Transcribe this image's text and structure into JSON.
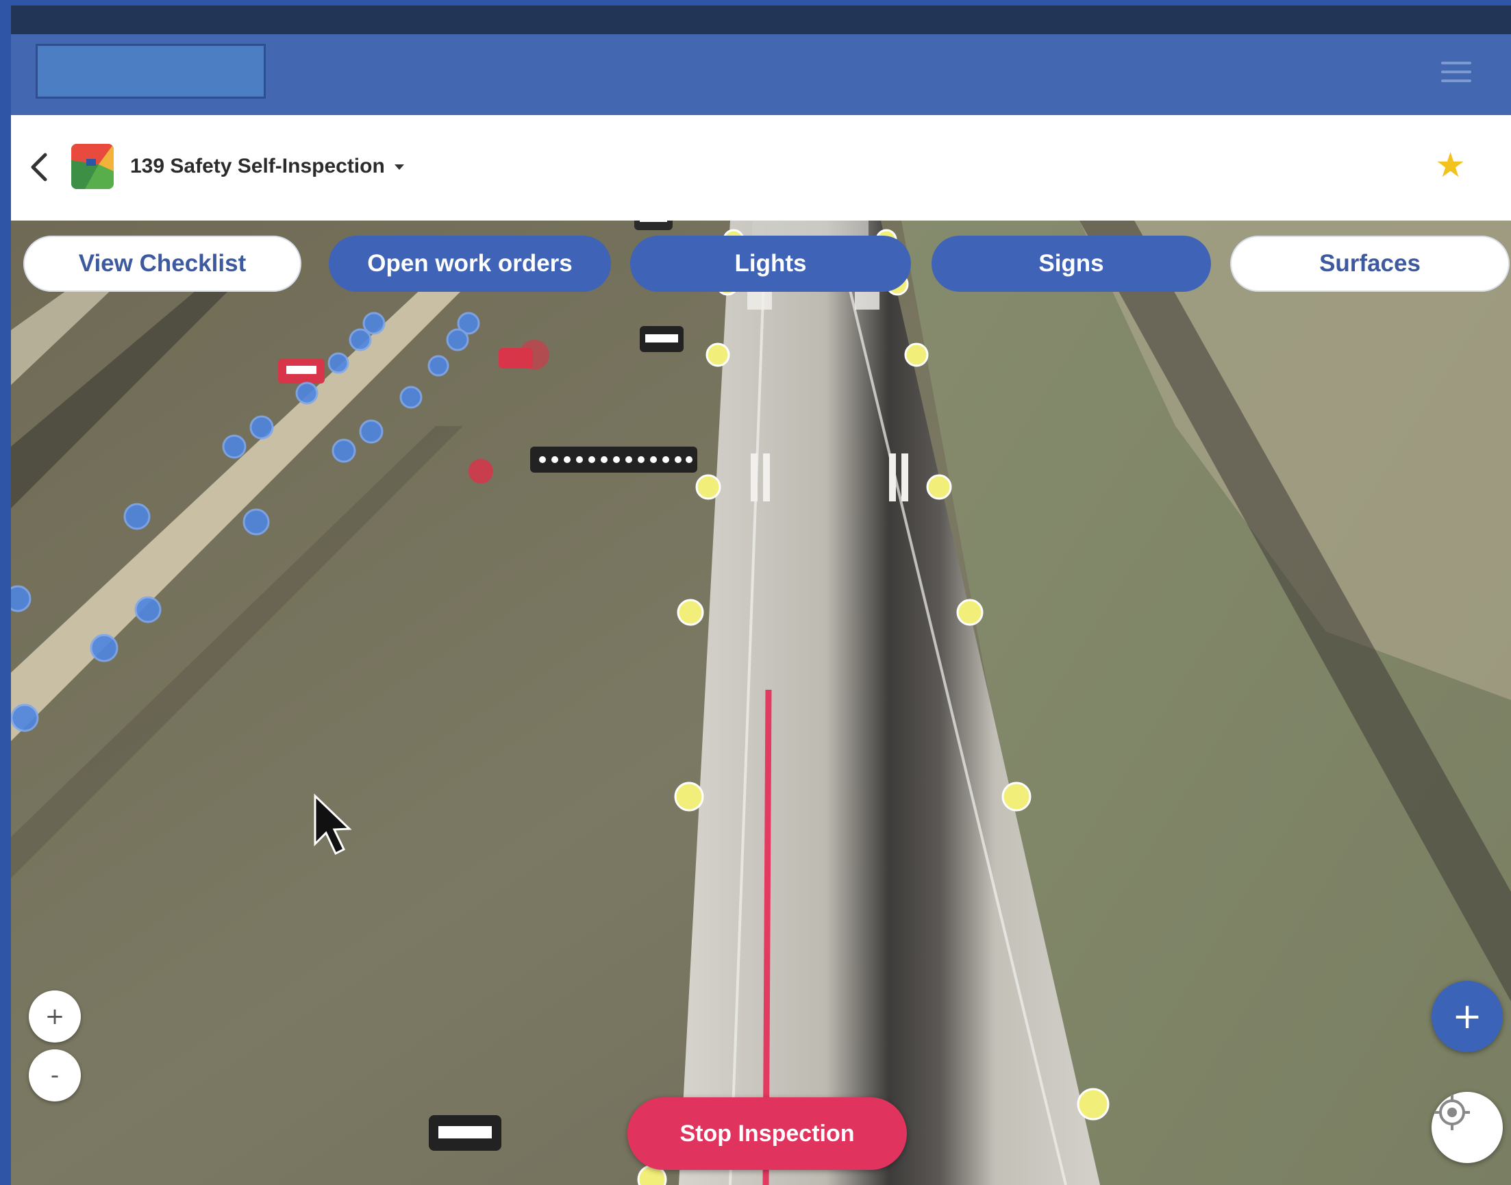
{
  "header": {
    "title": "139 Safety Self-Inspection",
    "icons": {
      "menu": "hamburger-menu-icon",
      "back": "back-chevron-icon",
      "favorite": "star-icon"
    }
  },
  "filters": [
    {
      "label": "View Checklist",
      "style": "light"
    },
    {
      "label": "Open work orders",
      "style": "dark"
    },
    {
      "label": "Lights",
      "style": "dark"
    },
    {
      "label": "Signs",
      "style": "dark"
    },
    {
      "label": "Surfaces",
      "style": "light"
    }
  ],
  "map": {
    "zoom_in": "+",
    "zoom_out": "-",
    "add": "+",
    "stop_label": "Stop Inspection"
  },
  "colors": {
    "brand_blue": "#3f63b6",
    "appbar": "#4367b0",
    "stop_red": "#e0345e",
    "star": "#f4c21f"
  }
}
